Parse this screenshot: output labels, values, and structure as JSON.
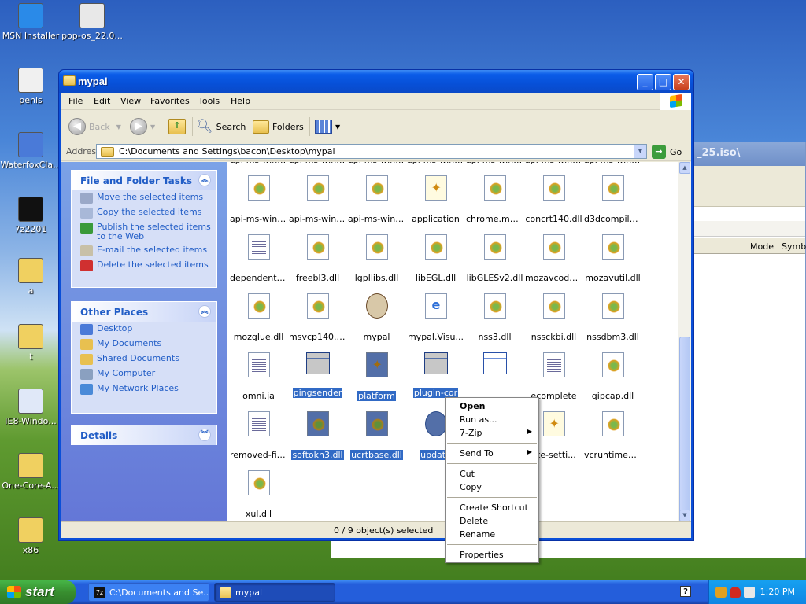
{
  "desktop": {
    "icons": [
      {
        "label": "MSN Installer"
      },
      {
        "label": "pop-os_22.0..."
      },
      {
        "label": "penis"
      },
      {
        "label": "WaterfoxCla..."
      },
      {
        "label": "7z2201"
      },
      {
        "label": "a"
      },
      {
        "label": "t"
      },
      {
        "label": "IE8-Windo..."
      },
      {
        "label": "One-Core-A..."
      },
      {
        "label": "x86"
      }
    ]
  },
  "bg_window": {
    "title": "_25.iso\\",
    "columns": [
      "Mode",
      "Symbo"
    ]
  },
  "window": {
    "title": "mypal",
    "menu": [
      "File",
      "Edit",
      "View",
      "Favorites",
      "Tools",
      "Help"
    ],
    "toolbar": {
      "back": "Back",
      "search": "Search",
      "folders": "Folders"
    },
    "address": {
      "label": "Address",
      "value": "C:\\Documents and Settings\\bacon\\Desktop\\mypal",
      "go": "Go"
    },
    "tasks_panel": {
      "title": "File and Folder Tasks",
      "items": [
        "Move the selected items",
        "Copy the selected items",
        "Publish the selected items to the Web",
        "E-mail the selected items",
        "Delete the selected items"
      ]
    },
    "places_panel": {
      "title": "Other Places",
      "items": [
        "Desktop",
        "My Documents",
        "Shared Documents",
        "My Computer",
        "My Network Places"
      ]
    },
    "details_panel": {
      "title": "Details"
    },
    "files": [
      {
        "label": "api-ms-win-...",
        "type": "dll",
        "sel": false
      },
      {
        "label": "api-ms-win-...",
        "type": "dll",
        "sel": false
      },
      {
        "label": "api-ms-win-...",
        "type": "dll",
        "sel": false
      },
      {
        "label": "api-ms-win-...",
        "type": "dll",
        "sel": false
      },
      {
        "label": "api-ms-win-...",
        "type": "dll",
        "sel": false
      },
      {
        "label": "api-ms-win-...",
        "type": "dll",
        "sel": false
      },
      {
        "label": "api-ms-win-...",
        "type": "dll",
        "sel": false
      },
      {
        "label": "api-ms-win-...",
        "type": "dll",
        "sel": false
      },
      {
        "label": "api-ms-win-...",
        "type": "dll",
        "sel": false
      },
      {
        "label": "api-ms-win-...",
        "type": "dll",
        "sel": false
      },
      {
        "label": "application",
        "type": "cfg",
        "sel": false
      },
      {
        "label": "chrome.man...",
        "type": "dll",
        "sel": false
      },
      {
        "label": "concrt140.dll",
        "type": "dll",
        "sel": false
      },
      {
        "label": "d3dcompiler...",
        "type": "dll",
        "sel": false
      },
      {
        "label": "dependentli...",
        "type": "txt",
        "sel": false
      },
      {
        "label": "freebl3.dll",
        "type": "dll",
        "sel": false
      },
      {
        "label": "lgpllibs.dll",
        "type": "dll",
        "sel": false
      },
      {
        "label": "libEGL.dll",
        "type": "dll",
        "sel": false
      },
      {
        "label": "libGLESv2.dll",
        "type": "dll",
        "sel": false
      },
      {
        "label": "mozavcodec...",
        "type": "dll",
        "sel": false
      },
      {
        "label": "mozavutil.dll",
        "type": "dll",
        "sel": false
      },
      {
        "label": "mozglue.dll",
        "type": "dll",
        "sel": false
      },
      {
        "label": "msvcp140.dll",
        "type": "dll",
        "sel": false
      },
      {
        "label": "mypal",
        "type": "pal",
        "sel": false
      },
      {
        "label": "mypal.Visu...",
        "type": "ie",
        "sel": false
      },
      {
        "label": "nss3.dll",
        "type": "dll",
        "sel": false
      },
      {
        "label": "nssckbi.dll",
        "type": "dll",
        "sel": false
      },
      {
        "label": "nssdbm3.dll",
        "type": "dll",
        "sel": false
      },
      {
        "label": "omni.ja",
        "type": "txt",
        "sel": false
      },
      {
        "label": "pingsender",
        "type": "exe",
        "sel": true
      },
      {
        "label": "platform",
        "type": "cfg",
        "sel": true
      },
      {
        "label": "plugin-cor",
        "type": "exe",
        "sel": true
      },
      {
        "label": "",
        "type": "exe",
        "sel": false
      },
      {
        "label": "ecomplete",
        "type": "txt",
        "sel": false
      },
      {
        "label": "qipcap.dll",
        "type": "dll",
        "sel": false
      },
      {
        "label": "removed-files",
        "type": "txt",
        "sel": false
      },
      {
        "label": "softokn3.dll",
        "type": "dll",
        "sel": true
      },
      {
        "label": "ucrtbase.dll",
        "type": "dll",
        "sel": true
      },
      {
        "label": "update",
        "type": "upd",
        "sel": true
      },
      {
        "label": "",
        "type": "txt",
        "sel": false
      },
      {
        "label": "ate-setti...",
        "type": "cfg",
        "sel": false
      },
      {
        "label": "vcruntime1...",
        "type": "dll",
        "sel": false
      },
      {
        "label": "xul.dll",
        "type": "dll",
        "sel": false
      }
    ],
    "status": "0 / 9 object(s) selected"
  },
  "context_menu": {
    "items": [
      {
        "label": "Open",
        "bold": true,
        "arrow": false
      },
      {
        "label": "Run as...",
        "bold": false,
        "arrow": false
      },
      {
        "label": "7-Zip",
        "bold": false,
        "arrow": true
      },
      {
        "sep": true
      },
      {
        "label": "Send To",
        "bold": false,
        "arrow": true
      },
      {
        "sep": true
      },
      {
        "label": "Cut",
        "bold": false,
        "arrow": false
      },
      {
        "label": "Copy",
        "bold": false,
        "arrow": false
      },
      {
        "sep": true
      },
      {
        "label": "Create Shortcut",
        "bold": false,
        "arrow": false
      },
      {
        "label": "Delete",
        "bold": false,
        "arrow": false
      },
      {
        "label": "Rename",
        "bold": false,
        "arrow": false
      },
      {
        "sep": true
      },
      {
        "label": "Properties",
        "bold": false,
        "arrow": false
      }
    ]
  },
  "taskbar": {
    "start": "start",
    "tasks": [
      {
        "label": "C:\\Documents and Se..."
      },
      {
        "label": "mypal"
      }
    ],
    "clock": "1:20 PM"
  }
}
